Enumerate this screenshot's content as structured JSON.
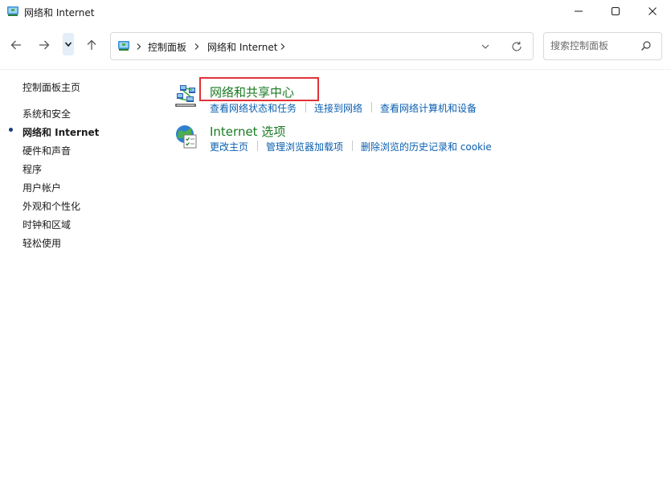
{
  "window": {
    "title": "网络和 Internet"
  },
  "nav": {
    "back_label": "后退",
    "forward_label": "前进",
    "up_label": "向上"
  },
  "address": {
    "crumbs": [
      "控制面板",
      "网络和 Internet"
    ]
  },
  "search": {
    "placeholder": "搜索控制面板"
  },
  "sidebar": {
    "home": "控制面板主页",
    "items": [
      {
        "label": "系统和安全",
        "active": false
      },
      {
        "label": "网络和 Internet",
        "active": true
      },
      {
        "label": "硬件和声音",
        "active": false
      },
      {
        "label": "程序",
        "active": false
      },
      {
        "label": "用户帐户",
        "active": false
      },
      {
        "label": "外观和个性化",
        "active": false
      },
      {
        "label": "时钟和区域",
        "active": false
      },
      {
        "label": "轻松使用",
        "active": false
      }
    ]
  },
  "categories": [
    {
      "title": "网络和共享中心",
      "icon": "network-sharing-center-icon",
      "highlighted": true,
      "tasks": [
        "查看网络状态和任务",
        "连接到网络",
        "查看网络计算机和设备"
      ]
    },
    {
      "title": "Internet 选项",
      "icon": "internet-options-icon",
      "highlighted": false,
      "tasks": [
        "更改主页",
        "管理浏览器加载项",
        "删除浏览的历史记录和 cookie"
      ]
    }
  ],
  "colors": {
    "category_title": "#1a7a22",
    "task_link": "#0a5fb0",
    "highlight_border": "#e0323a"
  }
}
